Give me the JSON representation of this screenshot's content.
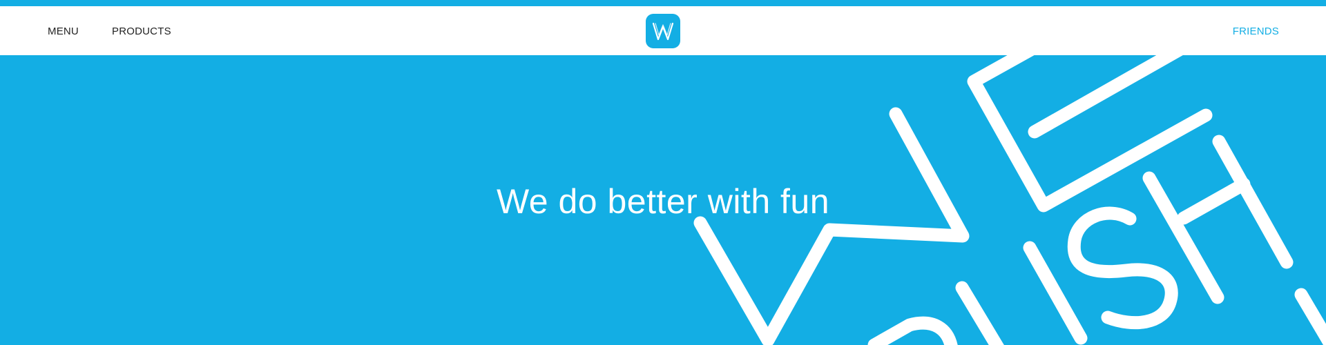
{
  "nav": {
    "menu_label": "MENU",
    "products_label": "PRODUCTS",
    "friends_label": "FRIENDS",
    "logo_letter": "W"
  },
  "hero": {
    "title": "We do better with fun",
    "art_icon": "wish-lettering-graphic"
  },
  "colors": {
    "brand_blue": "#13aee4",
    "nav_background": "#ffffff",
    "nav_text": "#222222",
    "accent_link": "#13aee4"
  }
}
